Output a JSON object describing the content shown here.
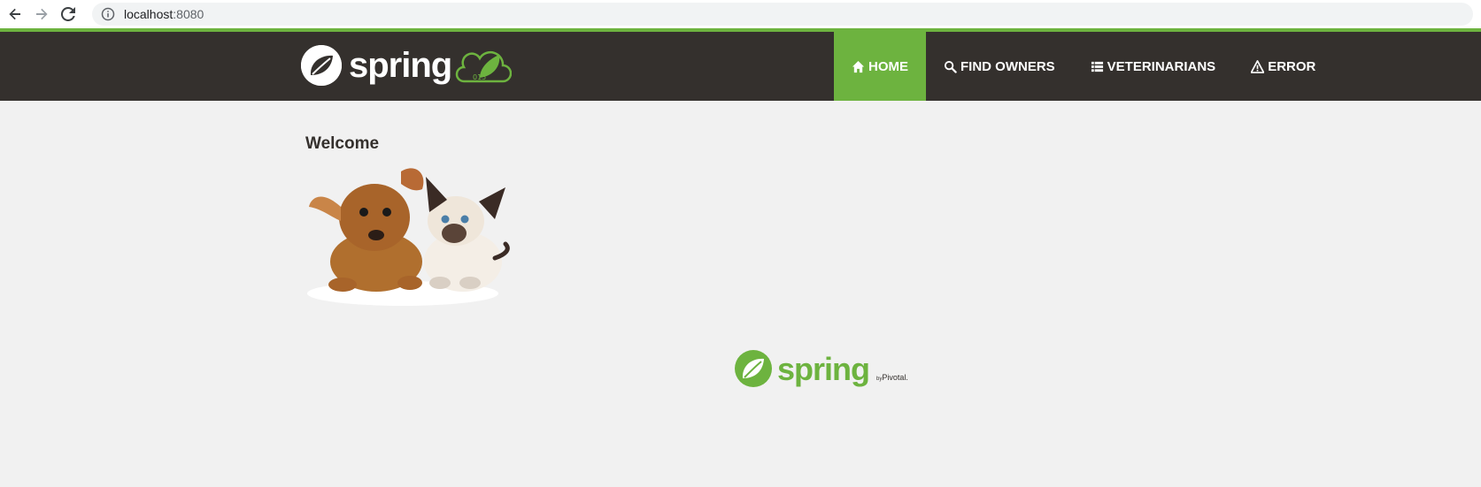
{
  "browser": {
    "url_host": "localhost",
    "url_port": ":8080",
    "icons": [
      "back-arrow-icon",
      "forward-arrow-icon",
      "reload-icon",
      "info-icon"
    ]
  },
  "navbar": {
    "brand_word": "spring",
    "brand_badge": "015",
    "items": [
      {
        "label": "Home",
        "icon": "home-icon",
        "active": true
      },
      {
        "label": "Find owners",
        "icon": "search-icon",
        "active": false
      },
      {
        "label": "Veterinarians",
        "icon": "list-icon",
        "active": false
      },
      {
        "label": "Error",
        "icon": "warning-icon",
        "active": false
      }
    ],
    "colors": {
      "bar": "#34302d",
      "accent": "#6db33f"
    }
  },
  "main": {
    "title": "Welcome",
    "image_desc": "puppy-and-kitten"
  },
  "footer": {
    "word": "spring",
    "by_prefix": "by",
    "by_company": "Pivotal."
  }
}
